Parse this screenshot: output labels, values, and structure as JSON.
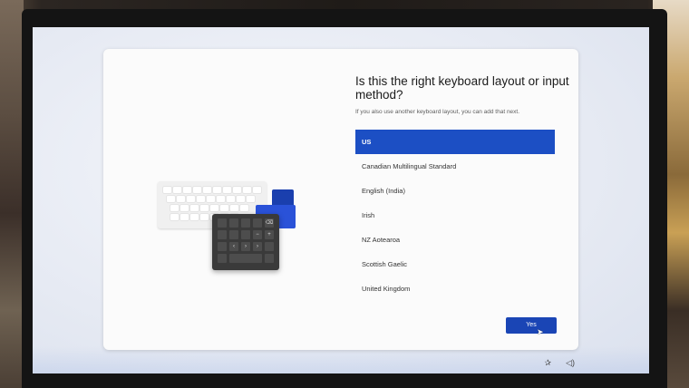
{
  "dialog": {
    "title": "Is this the right keyboard layout or input method?",
    "subtitle": "If you also use another keyboard layout, you can add that next.",
    "layouts": [
      {
        "label": "US",
        "selected": true
      },
      {
        "label": "Canadian Multilingual Standard",
        "selected": false
      },
      {
        "label": "English (India)",
        "selected": false
      },
      {
        "label": "Irish",
        "selected": false
      },
      {
        "label": "NZ Aotearoa",
        "selected": false
      },
      {
        "label": "Scottish Gaelic",
        "selected": false
      },
      {
        "label": "United Kingdom",
        "selected": false
      }
    ],
    "yes_label": "Yes"
  },
  "numpad_keys": [
    "⌫",
    "−",
    "+",
    "‹",
    "›",
    "›"
  ],
  "colors": {
    "accent": "#1c4fc4",
    "button": "#1a45b5",
    "card": "#fbfbfb"
  },
  "tray_icons": [
    "accessibility-icon",
    "volume-icon"
  ]
}
